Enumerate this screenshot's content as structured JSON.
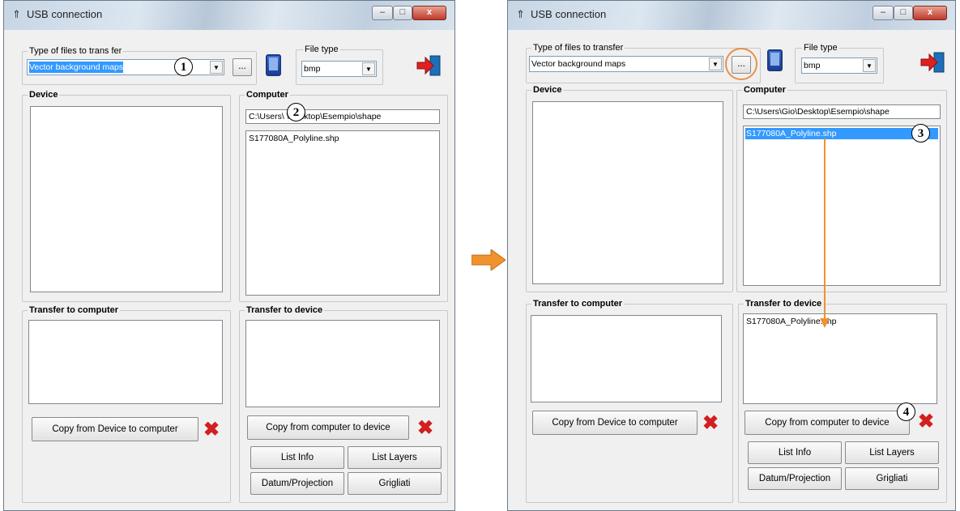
{
  "before_window": {
    "title": "USB connection",
    "controls": {
      "minimize": "–",
      "maximize": "□",
      "close": "x"
    },
    "type_group_label": "Type of files to trans fer",
    "type_value": "Vector background maps",
    "browse_label": "...",
    "file_type_label": "File type",
    "file_type_value": "bmp",
    "device_label": "Device",
    "computer_label": "Computer",
    "computer_path": "C:\\Users\\   \\Desktop\\Esempio\\shape",
    "computer_files": [
      "S177080A_Polyline.shp"
    ],
    "transfer_to_computer_label": "Transfer to computer",
    "transfer_to_device_label": "Transfer to device",
    "copy_device_to_computer": "Copy from Device to computer",
    "copy_computer_to_device": "Copy from computer to device",
    "list_info": "List Info",
    "list_layers": "List Layers",
    "datum_projection": "Datum/Projection",
    "grigliati": "Grigliati",
    "callouts": {
      "c1": "1",
      "c2": "2"
    }
  },
  "after_window": {
    "title": "USB connection",
    "controls": {
      "minimize": "–",
      "maximize": "□",
      "close": "x"
    },
    "type_group_label": "Type of files to transfer",
    "type_value": "Vector background maps",
    "browse_label": "...",
    "file_type_label": "File type",
    "file_type_value": "bmp",
    "device_label": "Device",
    "computer_label": "Computer",
    "computer_path": "C:\\Users\\Gio\\Desktop\\Esempio\\shape",
    "computer_files": [
      "S177080A_Polyline.shp"
    ],
    "transfer_to_computer_label": "Transfer to computer",
    "transfer_to_device_label": "Transfer to device",
    "transfer_to_device_files": [
      "S177080A_Polyline.shp"
    ],
    "copy_device_to_computer": "Copy from Device to computer",
    "copy_computer_to_device": "Copy from computer to device",
    "list_info": "List Info",
    "list_layers": "List Layers",
    "datum_projection": "Datum/Projection",
    "grigliati": "Grigliati",
    "callouts": {
      "c3": "3",
      "c4": "4"
    }
  },
  "colors": {
    "arrow": "#f0922e",
    "accent_select": "#3399ff",
    "delete_x": "#d21f1f",
    "exit_red": "#e02020",
    "exit_blue": "#1d6fb8"
  },
  "icons": [
    "device-icon",
    "exit-door-icon",
    "delete-x-icon",
    "arrow-right-icon",
    "usb-icon"
  ]
}
